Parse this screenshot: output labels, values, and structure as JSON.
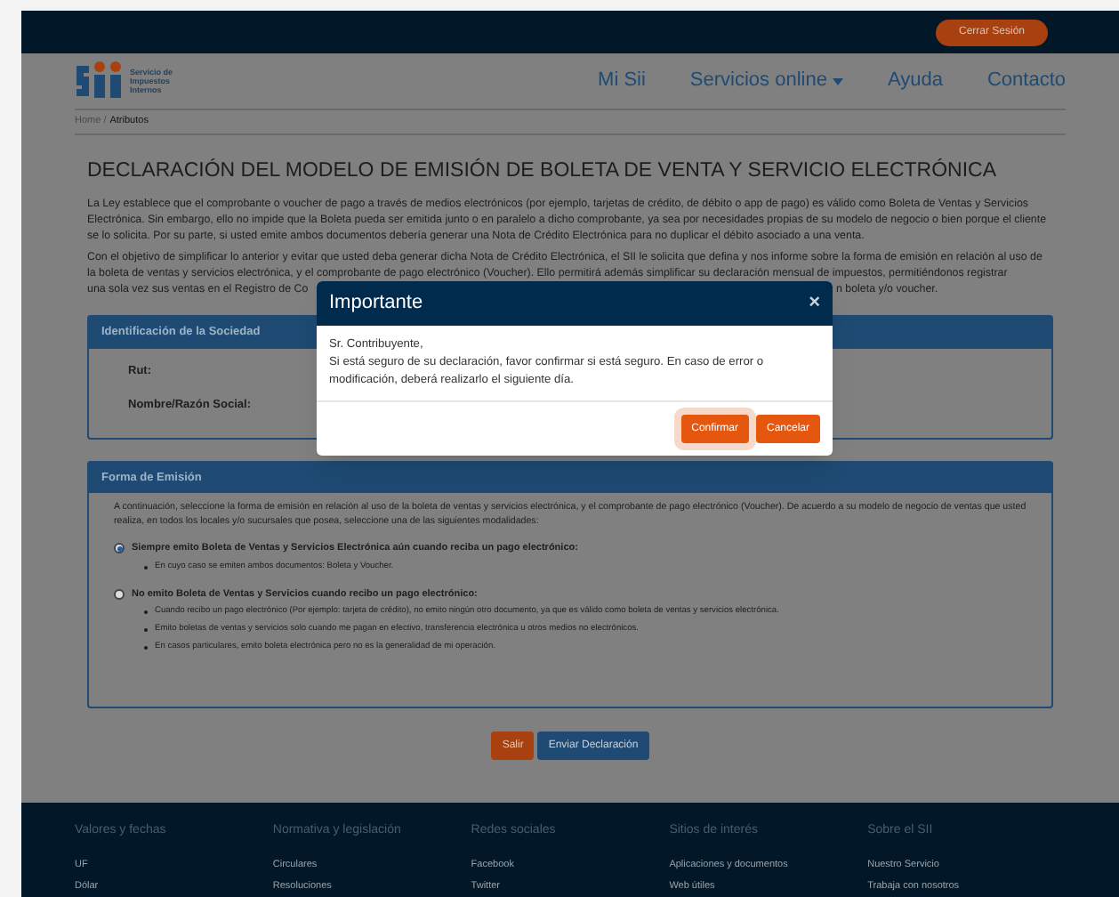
{
  "top_bar": {
    "logout_button": "Cerrar Sesión"
  },
  "header": {
    "logo_text": "Servicio de Impuestos Internos",
    "nav": [
      {
        "label": "Mi Sii",
        "dropdown": false
      },
      {
        "label": "Servicios online",
        "dropdown": true
      },
      {
        "label": "Ayuda",
        "dropdown": false
      },
      {
        "label": "Contacto",
        "dropdown": false
      }
    ]
  },
  "breadcrumb": [
    {
      "label": "Home",
      "separator": "/"
    },
    {
      "label": "Atributos"
    }
  ],
  "title": "DECLARACIÓN DEL MODELO DE EMISIÓN DE BOLETA DE VENTA Y SERVICIO ELECTRÓNICA",
  "intro": [
    "La Ley establece que el comprobante o voucher de pago a través de medios electrónicos (por ejemplo, tarjetas de crédito, de débito o app de pago) es válido como Boleta de Ventas y Servicios Electrónica. Sin embargo, ello no impide que la Boleta pueda ser emitida junto o en paralelo a dicho comprobante, ya sea por necesidades propias de su modelo de negocio o bien porque el cliente se lo solicita. Por su parte, si usted emite ambos documentos debería generar una Nota de Crédito Electrónica para no duplicar el débito asociado a una venta.",
    "Con el objetivo de simplificar lo anterior y evitar que usted deba generar dicha Nota de Crédito Electrónica, el SII le solicita que defina y nos informe sobre la forma de emisión en relación al uso de la boleta de ventas y servicios electrónica, y el comprobante de pago electrónico (Voucher). Ello permitirá además simplificar su declaración mensual de impuestos, permitiéndonos registrar"
  ],
  "intro_hidden_line": {
    "left": "una sola vez sus ventas en el Registro de Co",
    "right": "n boleta y/o voucher."
  },
  "identification": {
    "title": "Identificación de la Sociedad",
    "fields": [
      "Rut:",
      "Nombre/Razón Social:"
    ]
  },
  "emission": {
    "title": "Forma de Emisión",
    "description": "A continuación, seleccione la forma de emisión en relación al uso de la boleta de ventas y servicios electrónica, y el comprobante de pago electrónico (Voucher). De acuerdo a su modelo de negocio de ventas que usted realiza, en todos los locales y/o sucursales que posea, seleccione una de las siguientes modalidades:",
    "options": [
      {
        "label": "Siempre emito Boleta de Ventas y Servicios Electrónica aún cuando reciba un pago electrónico:",
        "selected": true,
        "bullets": [
          "En cuyo caso se emiten ambos documentos: Boleta y Voucher."
        ]
      },
      {
        "label": "No emito Boleta de Ventas y Servicios cuando recibo un pago electrónico:",
        "selected": false,
        "bullets": [
          "Cuando recibo un pago electrónico (Por ejemplo: tarjeta de crédito), no emito ningún otro documento, ya que es válido como boleta de ventas y servicios electrónica.",
          "Emito boletas de ventas y servicios solo cuando me pagan en efectivo, transferencia electrónica u otros medios no electrónicos.",
          "En casos particulares, emito boleta electrónica pero no es la generalidad de mi operación."
        ]
      }
    ]
  },
  "actions": [
    {
      "label": "Salir",
      "kind": "danger"
    },
    {
      "label": "Enviar Declaración",
      "kind": "primary"
    }
  ],
  "footer": [
    {
      "title": "Valores y fechas",
      "links": [
        "UF",
        "Dólar"
      ]
    },
    {
      "title": "Normativa y legislación",
      "links": [
        "Circulares",
        "Resoluciones"
      ]
    },
    {
      "title": "Redes sociales",
      "links": [
        "Facebook",
        "Twitter"
      ]
    },
    {
      "title": "Sitios de interés",
      "links": [
        "Aplicaciones y documentos",
        "Web útiles"
      ]
    },
    {
      "title": "Sobre el SII",
      "links": [
        "Nuestro Servicio",
        "Trabaja con nosotros"
      ]
    }
  ],
  "modal": {
    "title": "Importante",
    "close": "×",
    "body": [
      "Sr. Contribuyente,",
      "Si está seguro de su declaración, favor confirmar si está seguro. En caso de error o modificación, deberá realizarlo el siguiente día."
    ],
    "buttons": [
      {
        "label": "Confirmar",
        "focused": true
      },
      {
        "label": "Cancelar",
        "focused": false
      }
    ]
  }
}
